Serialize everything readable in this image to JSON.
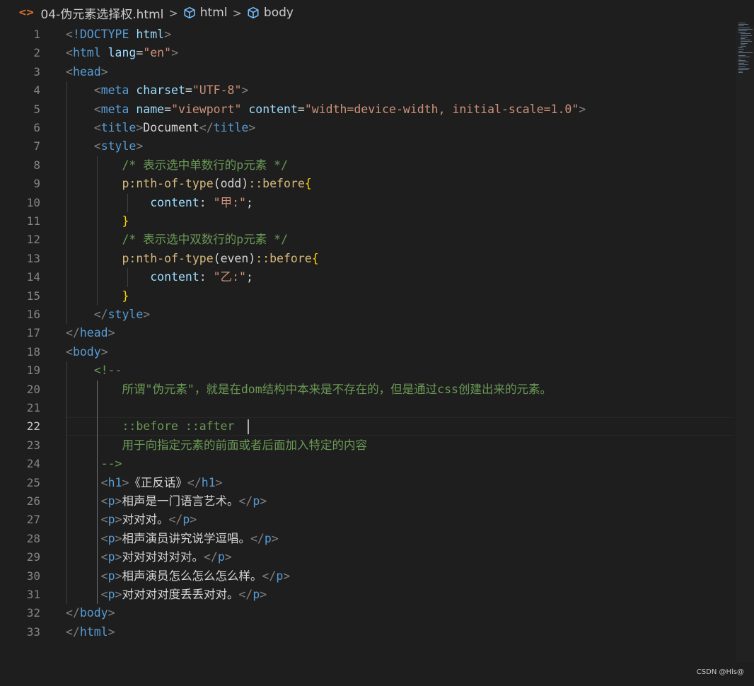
{
  "breadcrumb": {
    "file_icon": "<>",
    "file": "04-伪元素选择权.html",
    "sep": ">",
    "node1": "html",
    "node2": "body"
  },
  "editor": {
    "active_line": 22,
    "lines": [
      {
        "num": "1",
        "tokens": [
          [
            "t",
            "<"
          ],
          [
            "n",
            "!DOCTYPE"
          ],
          [
            "p",
            " "
          ],
          [
            "a",
            "html"
          ],
          [
            "t",
            ">"
          ]
        ]
      },
      {
        "num": "2",
        "tokens": [
          [
            "t",
            "<"
          ],
          [
            "n",
            "html"
          ],
          [
            "p",
            " "
          ],
          [
            "a",
            "lang"
          ],
          [
            "p",
            "="
          ],
          [
            "s",
            "\"en\""
          ],
          [
            "t",
            ">"
          ]
        ]
      },
      {
        "num": "3",
        "tokens": [
          [
            "t",
            "<"
          ],
          [
            "n",
            "head"
          ],
          [
            "t",
            ">"
          ]
        ]
      },
      {
        "num": "4",
        "tokens": [
          [
            "p",
            "    "
          ],
          [
            "t",
            "<"
          ],
          [
            "n",
            "meta"
          ],
          [
            "p",
            " "
          ],
          [
            "a",
            "charset"
          ],
          [
            "p",
            "="
          ],
          [
            "s",
            "\"UTF-8\""
          ],
          [
            "t",
            ">"
          ]
        ]
      },
      {
        "num": "5",
        "tokens": [
          [
            "p",
            "    "
          ],
          [
            "t",
            "<"
          ],
          [
            "n",
            "meta"
          ],
          [
            "p",
            " "
          ],
          [
            "a",
            "name"
          ],
          [
            "p",
            "="
          ],
          [
            "s",
            "\"viewport\""
          ],
          [
            "p",
            " "
          ],
          [
            "a",
            "content"
          ],
          [
            "p",
            "="
          ],
          [
            "s",
            "\"width=device-width, initial-scale=1.0\""
          ],
          [
            "t",
            ">"
          ]
        ]
      },
      {
        "num": "6",
        "tokens": [
          [
            "p",
            "    "
          ],
          [
            "t",
            "<"
          ],
          [
            "n",
            "title"
          ],
          [
            "t",
            ">"
          ],
          [
            "p",
            "Document"
          ],
          [
            "t",
            "</"
          ],
          [
            "n",
            "title"
          ],
          [
            "t",
            ">"
          ]
        ]
      },
      {
        "num": "7",
        "tokens": [
          [
            "p",
            "    "
          ],
          [
            "t",
            "<"
          ],
          [
            "n",
            "style"
          ],
          [
            "t",
            ">"
          ]
        ]
      },
      {
        "num": "8",
        "tokens": [
          [
            "p",
            "        "
          ],
          [
            "c",
            "/* 表示选中单数行的p元素 */"
          ]
        ]
      },
      {
        "num": "9",
        "tokens": [
          [
            "p",
            "        "
          ],
          [
            "sel",
            "p:nth-of-type"
          ],
          [
            "p",
            "("
          ],
          [
            "p",
            "odd"
          ],
          [
            "p",
            ")"
          ],
          [
            "sel",
            "::before"
          ],
          [
            "b",
            "{"
          ]
        ]
      },
      {
        "num": "10",
        "tokens": [
          [
            "p",
            "            "
          ],
          [
            "a",
            "content"
          ],
          [
            "p",
            ": "
          ],
          [
            "s",
            "\"甲:\""
          ],
          [
            "p",
            ";"
          ]
        ]
      },
      {
        "num": "11",
        "tokens": [
          [
            "p",
            "        "
          ],
          [
            "b",
            "}"
          ]
        ]
      },
      {
        "num": "12",
        "tokens": [
          [
            "p",
            "        "
          ],
          [
            "c",
            "/* 表示选中双数行的p元素 */"
          ]
        ]
      },
      {
        "num": "13",
        "tokens": [
          [
            "p",
            "        "
          ],
          [
            "sel",
            "p:nth-of-type"
          ],
          [
            "p",
            "("
          ],
          [
            "p",
            "even"
          ],
          [
            "p",
            ")"
          ],
          [
            "sel",
            "::before"
          ],
          [
            "b",
            "{"
          ]
        ]
      },
      {
        "num": "14",
        "tokens": [
          [
            "p",
            "            "
          ],
          [
            "a",
            "content"
          ],
          [
            "p",
            ": "
          ],
          [
            "s",
            "\"乙:\""
          ],
          [
            "p",
            ";"
          ]
        ]
      },
      {
        "num": "15",
        "tokens": [
          [
            "p",
            "        "
          ],
          [
            "b",
            "}"
          ]
        ]
      },
      {
        "num": "16",
        "tokens": [
          [
            "p",
            "    "
          ],
          [
            "t",
            "</"
          ],
          [
            "n",
            "style"
          ],
          [
            "t",
            ">"
          ]
        ]
      },
      {
        "num": "17",
        "tokens": [
          [
            "t",
            "</"
          ],
          [
            "n",
            "head"
          ],
          [
            "t",
            ">"
          ]
        ]
      },
      {
        "num": "18",
        "tokens": [
          [
            "t",
            "<"
          ],
          [
            "n",
            "body"
          ],
          [
            "t",
            ">"
          ]
        ]
      },
      {
        "num": "19",
        "tokens": [
          [
            "p",
            "    "
          ],
          [
            "c",
            "<!--"
          ]
        ]
      },
      {
        "num": "20",
        "tokens": [
          [
            "p",
            "        "
          ],
          [
            "c",
            "所谓\"伪元素\"，就是在dom结构中本来是不存在的，但是通过css创建出来的元素。"
          ]
        ]
      },
      {
        "num": "21",
        "tokens": []
      },
      {
        "num": "22",
        "tokens": [
          [
            "p",
            "        "
          ],
          [
            "c",
            "::before ::after"
          ]
        ]
      },
      {
        "num": "23",
        "tokens": [
          [
            "p",
            "        "
          ],
          [
            "c",
            "用于向指定元素的前面或者后面加入特定的内容"
          ]
        ]
      },
      {
        "num": "24",
        "tokens": [
          [
            "p",
            "     "
          ],
          [
            "c",
            "-->"
          ]
        ]
      },
      {
        "num": "25",
        "tokens": [
          [
            "p",
            "     "
          ],
          [
            "t",
            "<"
          ],
          [
            "n",
            "h1"
          ],
          [
            "t",
            ">"
          ],
          [
            "p",
            "《正反话》"
          ],
          [
            "t",
            "</"
          ],
          [
            "n",
            "h1"
          ],
          [
            "t",
            ">"
          ]
        ]
      },
      {
        "num": "26",
        "tokens": [
          [
            "p",
            "     "
          ],
          [
            "t",
            "<"
          ],
          [
            "n",
            "p"
          ],
          [
            "t",
            ">"
          ],
          [
            "p",
            "相声是一门语言艺术。"
          ],
          [
            "t",
            "</"
          ],
          [
            "n",
            "p"
          ],
          [
            "t",
            ">"
          ]
        ]
      },
      {
        "num": "27",
        "tokens": [
          [
            "p",
            "     "
          ],
          [
            "t",
            "<"
          ],
          [
            "n",
            "p"
          ],
          [
            "t",
            ">"
          ],
          [
            "p",
            "对对对。"
          ],
          [
            "t",
            "</"
          ],
          [
            "n",
            "p"
          ],
          [
            "t",
            ">"
          ]
        ]
      },
      {
        "num": "28",
        "tokens": [
          [
            "p",
            "     "
          ],
          [
            "t",
            "<"
          ],
          [
            "n",
            "p"
          ],
          [
            "t",
            ">"
          ],
          [
            "p",
            "相声演员讲究说学逗唱。"
          ],
          [
            "t",
            "</"
          ],
          [
            "n",
            "p"
          ],
          [
            "t",
            ">"
          ]
        ]
      },
      {
        "num": "29",
        "tokens": [
          [
            "p",
            "     "
          ],
          [
            "t",
            "<"
          ],
          [
            "n",
            "p"
          ],
          [
            "t",
            ">"
          ],
          [
            "p",
            "对对对对对对。"
          ],
          [
            "t",
            "</"
          ],
          [
            "n",
            "p"
          ],
          [
            "t",
            ">"
          ]
        ]
      },
      {
        "num": "30",
        "tokens": [
          [
            "p",
            "     "
          ],
          [
            "t",
            "<"
          ],
          [
            "n",
            "p"
          ],
          [
            "t",
            ">"
          ],
          [
            "p",
            "相声演员怎么怎么怎么样。"
          ],
          [
            "t",
            "</"
          ],
          [
            "n",
            "p"
          ],
          [
            "t",
            ">"
          ]
        ]
      },
      {
        "num": "31",
        "tokens": [
          [
            "p",
            "     "
          ],
          [
            "t",
            "<"
          ],
          [
            "n",
            "p"
          ],
          [
            "t",
            ">"
          ],
          [
            "p",
            "对对对对度丢丢对对。"
          ],
          [
            "t",
            "</"
          ],
          [
            "n",
            "p"
          ],
          [
            "t",
            ">"
          ]
        ]
      },
      {
        "num": "32",
        "tokens": [
          [
            "t",
            "</"
          ],
          [
            "n",
            "body"
          ],
          [
            "t",
            ">"
          ]
        ]
      },
      {
        "num": "33",
        "tokens": [
          [
            "t",
            "</"
          ],
          [
            "n",
            "html"
          ],
          [
            "t",
            ">"
          ]
        ]
      }
    ]
  },
  "watermark": "CSDN @Hls@",
  "colors": {
    "background": "#1e1e1e",
    "tag": "#569cd6",
    "attribute": "#9cdcfe",
    "string": "#ce9178",
    "comment": "#6a9955",
    "selector": "#d7ba7d",
    "brace": "#ffd700"
  }
}
